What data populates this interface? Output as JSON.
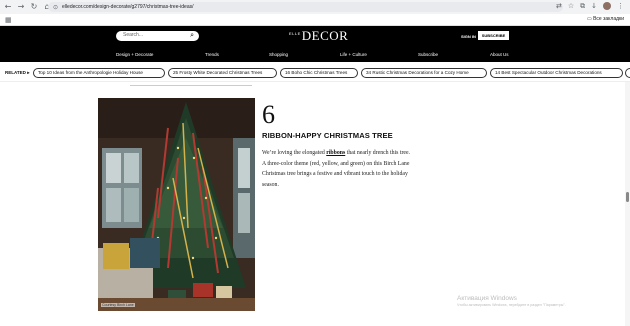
{
  "browser": {
    "url": "elledecor.com/design-decorate/g2797/christmas-tree-ideas/",
    "all_bookmarks": "Все закладки"
  },
  "header": {
    "search_placeholder": "Search...",
    "logo_prefix": "ELLE",
    "logo": "DECOR",
    "sign_in": "SIGN IN",
    "subscribe": "SUBSCRIBE",
    "nav": [
      "Design + Decorate",
      "Trends",
      "Shopping",
      "Life + Culture",
      "Subscribe",
      "About Us"
    ]
  },
  "related": {
    "label": "RELATED",
    "items": [
      "Top 10 Ideas from the Anthropologie Holiday House",
      "25 Frosty White Decorated Christmas Trees",
      "16 Boho Chic Christmas Trees",
      "34 Rustic Christmas Decorations for a Cozy Home",
      "14 Best Spectacular Outdoor Christmas Decorations"
    ]
  },
  "article": {
    "number": "6",
    "title": "RIBBON-HAPPY CHRISTMAS TREE",
    "desc_before": "We’re loving the elongated ",
    "desc_link": "ribbons",
    "desc_after": " that nearly drench this tree. A three-color theme (red, yellow, and green) on this Birch Lane Christmas tree brings a festive and vibrant touch to the holiday season.",
    "photo_credit": "Courtesy Birch Lane"
  },
  "watermark": {
    "title": "Активация Windows",
    "subtitle": "Чтобы активировать Windows, перейдите в раздел \"Параметры\"."
  }
}
